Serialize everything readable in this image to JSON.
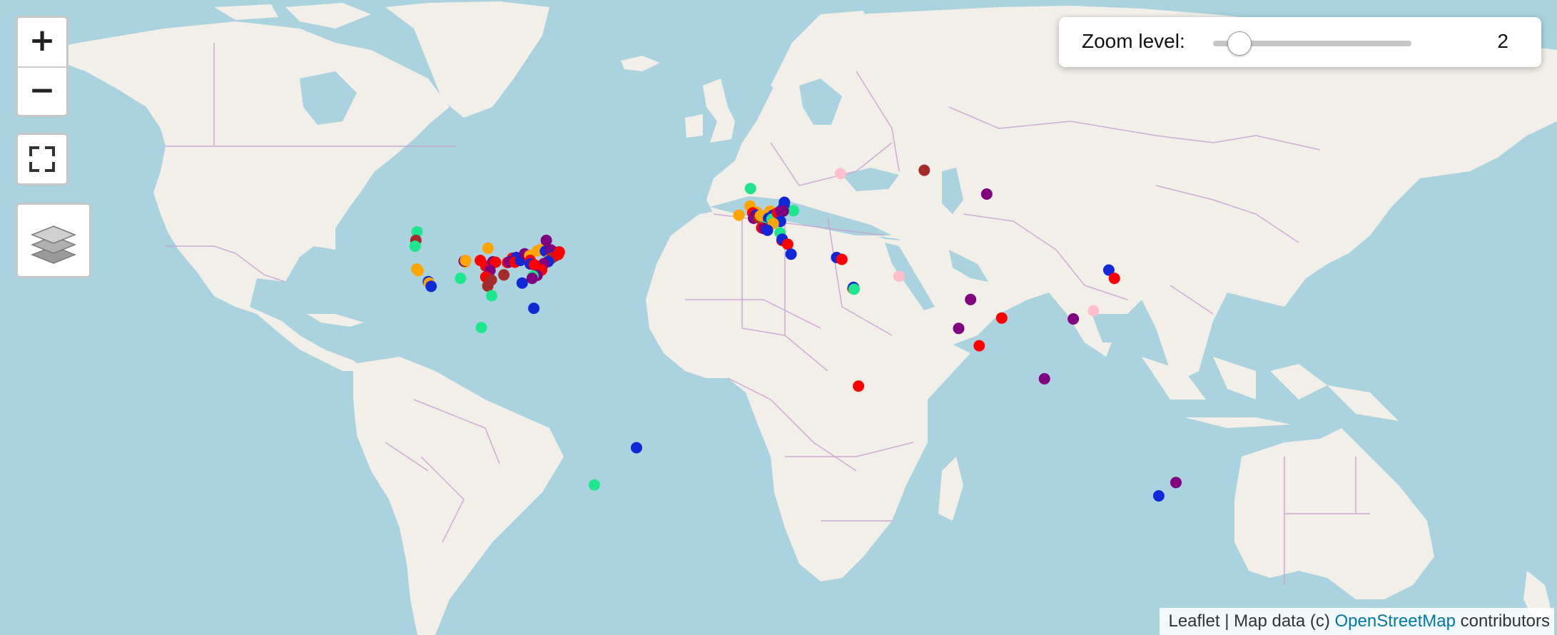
{
  "map": {
    "zoom_level_label": "Zoom level:",
    "zoom_level": "2",
    "zoom_in_label": "+",
    "zoom_out_label": "−",
    "attribution": {
      "leaflet": "Leaflet",
      "sep": " | ",
      "mapdata": "Map data (c) ",
      "osm": "OpenStreetMap",
      "contributors": " contributors"
    },
    "colors": {
      "water": "#aad3df",
      "land": "#f2efe9",
      "border": "#c8a0d2",
      "red": "#ff0000",
      "blue": "#1228d6",
      "green": "#1ee68c",
      "orange": "#ffa500",
      "purple": "#800080",
      "brown": "#a52a2a",
      "pink": "#ffc0cb"
    },
    "markers": [
      {
        "lat": 47.6,
        "lon": -122.3,
        "color": "green"
      },
      {
        "lat": 45.5,
        "lon": -122.7,
        "color": "brown"
      },
      {
        "lat": 44.0,
        "lon": -123.0,
        "color": "green"
      },
      {
        "lat": 37.8,
        "lon": -122.4,
        "color": "orange"
      },
      {
        "lat": 37.3,
        "lon": -121.9,
        "color": "orange"
      },
      {
        "lat": 34.1,
        "lon": -118.2,
        "color": "blue"
      },
      {
        "lat": 33.7,
        "lon": -117.9,
        "color": "orange"
      },
      {
        "lat": 32.7,
        "lon": -117.2,
        "color": "blue"
      },
      {
        "lat": 39.7,
        "lon": -105.0,
        "color": "orange"
      },
      {
        "lat": 40.0,
        "lon": -105.3,
        "color": "purple"
      },
      {
        "lat": 40.2,
        "lon": -104.8,
        "color": "orange"
      },
      {
        "lat": 43.5,
        "lon": -96.7,
        "color": "orange"
      },
      {
        "lat": 40.2,
        "lon": -99.5,
        "color": "red"
      },
      {
        "lat": 38.6,
        "lon": -97.5,
        "color": "red"
      },
      {
        "lat": 39.8,
        "lon": -95.0,
        "color": "purple"
      },
      {
        "lat": 39.7,
        "lon": -94.0,
        "color": "red"
      },
      {
        "lat": 37.4,
        "lon": -96.0,
        "color": "purple"
      },
      {
        "lat": 36.1,
        "lon": -91.0,
        "color": "brown"
      },
      {
        "lat": 35.1,
        "lon": -106.6,
        "color": "green"
      },
      {
        "lat": 35.5,
        "lon": -97.5,
        "color": "red"
      },
      {
        "lat": 34.6,
        "lon": -95.5,
        "color": "brown"
      },
      {
        "lat": 32.8,
        "lon": -96.8,
        "color": "brown"
      },
      {
        "lat": 29.8,
        "lon": -95.4,
        "color": "green"
      },
      {
        "lat": 39.6,
        "lon": -89.7,
        "color": "red"
      },
      {
        "lat": 40.8,
        "lon": -87.9,
        "color": "red"
      },
      {
        "lat": 41.0,
        "lon": -86.5,
        "color": "blue"
      },
      {
        "lat": 39.8,
        "lon": -89.0,
        "color": "purple"
      },
      {
        "lat": 39.7,
        "lon": -87.0,
        "color": "red"
      },
      {
        "lat": 40.2,
        "lon": -85.0,
        "color": "blue"
      },
      {
        "lat": 42.0,
        "lon": -83.5,
        "color": "purple"
      },
      {
        "lat": 41.5,
        "lon": -81.7,
        "color": "orange"
      },
      {
        "lat": 42.8,
        "lon": -78.9,
        "color": "orange"
      },
      {
        "lat": 43.2,
        "lon": -77.6,
        "color": "orange"
      },
      {
        "lat": 42.7,
        "lon": -76.0,
        "color": "blue"
      },
      {
        "lat": 43.0,
        "lon": -74.0,
        "color": "purple"
      },
      {
        "lat": 45.5,
        "lon": -75.7,
        "color": "purple"
      },
      {
        "lat": 42.4,
        "lon": -71.1,
        "color": "blue"
      },
      {
        "lat": 42.4,
        "lon": -72.5,
        "color": "purple"
      },
      {
        "lat": 41.8,
        "lon": -72.7,
        "color": "blue"
      },
      {
        "lat": 41.3,
        "lon": -72.9,
        "color": "purple"
      },
      {
        "lat": 40.7,
        "lon": -74.0,
        "color": "brown"
      },
      {
        "lat": 40.4,
        "lon": -74.7,
        "color": "orange"
      },
      {
        "lat": 40.0,
        "lon": -75.2,
        "color": "orange"
      },
      {
        "lat": 40.9,
        "lon": -73.8,
        "color": "brown"
      },
      {
        "lat": 41.8,
        "lon": -71.4,
        "color": "red"
      },
      {
        "lat": 42.5,
        "lon": -71.0,
        "color": "red"
      },
      {
        "lat": 39.9,
        "lon": -75.0,
        "color": "blue"
      },
      {
        "lat": 38.9,
        "lon": -77.0,
        "color": "blue"
      },
      {
        "lat": 38.6,
        "lon": -77.8,
        "color": "orange"
      },
      {
        "lat": 39.3,
        "lon": -76.6,
        "color": "purple"
      },
      {
        "lat": 37.5,
        "lon": -77.4,
        "color": "red"
      },
      {
        "lat": 40.2,
        "lon": -81.5,
        "color": "red"
      },
      {
        "lat": 39.2,
        "lon": -81.5,
        "color": "blue"
      },
      {
        "lat": 39.0,
        "lon": -80.0,
        "color": "red"
      },
      {
        "lat": 36.0,
        "lon": -79.0,
        "color": "purple"
      },
      {
        "lat": 35.8,
        "lon": -80.5,
        "color": "green"
      },
      {
        "lat": 35.1,
        "lon": -80.8,
        "color": "purple"
      },
      {
        "lat": 33.7,
        "lon": -84.4,
        "color": "blue"
      },
      {
        "lat": 25.8,
        "lon": -80.2,
        "color": "blue"
      },
      {
        "lat": 19.4,
        "lon": -99.1,
        "color": "green"
      },
      {
        "lat": -22.9,
        "lon": -43.2,
        "color": "blue"
      },
      {
        "lat": -34.6,
        "lon": -58.4,
        "color": "green"
      },
      {
        "lat": 57.1,
        "lon": -2.1,
        "color": "green"
      },
      {
        "lat": 53.5,
        "lon": -2.3,
        "color": "orange"
      },
      {
        "lat": 52.2,
        "lon": 0.1,
        "color": "orange"
      },
      {
        "lat": 51.5,
        "lon": -6.3,
        "color": "orange"
      },
      {
        "lat": 52.0,
        "lon": -1.3,
        "color": "red"
      },
      {
        "lat": 51.5,
        "lon": -0.1,
        "color": "blue"
      },
      {
        "lat": 51.0,
        "lon": 0.5,
        "color": "red"
      },
      {
        "lat": 50.8,
        "lon": -1.0,
        "color": "purple"
      },
      {
        "lat": 50.9,
        "lon": 0.9,
        "color": "brown"
      },
      {
        "lat": 51.4,
        "lon": 1.5,
        "color": "orange"
      },
      {
        "lat": 52.4,
        "lon": 4.9,
        "color": "orange"
      },
      {
        "lat": 51.9,
        "lon": 4.5,
        "color": "orange"
      },
      {
        "lat": 50.8,
        "lon": 4.4,
        "color": "blue"
      },
      {
        "lat": 51.5,
        "lon": 6.0,
        "color": "blue"
      },
      {
        "lat": 50.6,
        "lon": 5.6,
        "color": "green"
      },
      {
        "lat": 52.0,
        "lon": 7.6,
        "color": "red"
      },
      {
        "lat": 52.5,
        "lon": 8.8,
        "color": "purple"
      },
      {
        "lat": 53.0,
        "lon": 10.0,
        "color": "red"
      },
      {
        "lat": 53.6,
        "lon": 10.0,
        "color": "blue"
      },
      {
        "lat": 54.3,
        "lon": 10.1,
        "color": "blue"
      },
      {
        "lat": 52.5,
        "lon": 13.4,
        "color": "green"
      },
      {
        "lat": 52.4,
        "lon": 9.7,
        "color": "purple"
      },
      {
        "lat": 50.1,
        "lon": 8.7,
        "color": "blue"
      },
      {
        "lat": 49.6,
        "lon": 6.1,
        "color": "orange"
      },
      {
        "lat": 48.8,
        "lon": 2.3,
        "color": "green"
      },
      {
        "lat": 48.6,
        "lon": 1.9,
        "color": "red"
      },
      {
        "lat": 48.4,
        "lon": 2.7,
        "color": "purple"
      },
      {
        "lat": 48.0,
        "lon": 4.0,
        "color": "blue"
      },
      {
        "lat": 47.4,
        "lon": 8.5,
        "color": "green"
      },
      {
        "lat": 45.5,
        "lon": 9.2,
        "color": "red"
      },
      {
        "lat": 45.8,
        "lon": 9.3,
        "color": "blue"
      },
      {
        "lat": 44.5,
        "lon": 11.3,
        "color": "red"
      },
      {
        "lat": 41.9,
        "lon": 12.5,
        "color": "blue"
      },
      {
        "lat": 41.0,
        "lon": 28.9,
        "color": "blue"
      },
      {
        "lat": 40.5,
        "lon": 30.8,
        "color": "red"
      },
      {
        "lat": 32.1,
        "lon": 34.8,
        "color": "red"
      },
      {
        "lat": 32.4,
        "lon": 35.0,
        "color": "blue"
      },
      {
        "lat": 31.8,
        "lon": 35.2,
        "color": "green"
      },
      {
        "lat": -1.3,
        "lon": 36.8,
        "color": "red"
      },
      {
        "lat": 59.9,
        "lon": 30.3,
        "color": "pink"
      },
      {
        "lat": 60.5,
        "lon": 60.5,
        "color": "brown"
      },
      {
        "lat": 56.0,
        "lon": 83.0,
        "color": "purple"
      },
      {
        "lat": 35.7,
        "lon": 51.4,
        "color": "pink"
      },
      {
        "lat": 28.6,
        "lon": 77.2,
        "color": "purple"
      },
      {
        "lat": 19.1,
        "lon": 72.9,
        "color": "purple"
      },
      {
        "lat": 22.6,
        "lon": 88.4,
        "color": "red"
      },
      {
        "lat": 13.1,
        "lon": 80.3,
        "color": "red"
      },
      {
        "lat": 1.3,
        "lon": 103.8,
        "color": "purple"
      },
      {
        "lat": 22.3,
        "lon": 114.2,
        "color": "purple"
      },
      {
        "lat": 25.0,
        "lon": 121.5,
        "color": "pink"
      },
      {
        "lat": 37.5,
        "lon": 127.0,
        "color": "blue"
      },
      {
        "lat": 35.1,
        "lon": 129.0,
        "color": "red"
      },
      {
        "lat": -33.9,
        "lon": 151.2,
        "color": "purple"
      },
      {
        "lat": -37.8,
        "lon": 145.0,
        "color": "blue"
      }
    ]
  }
}
